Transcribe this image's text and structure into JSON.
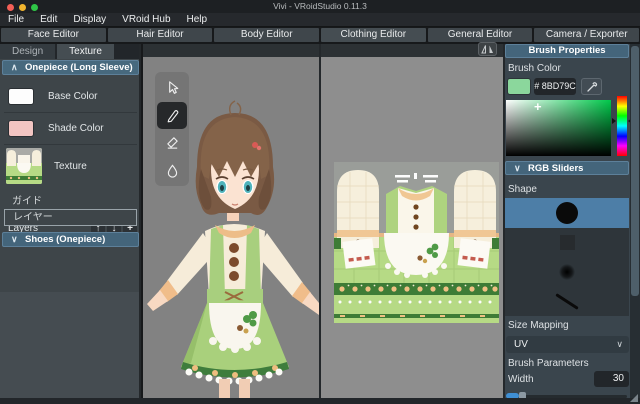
{
  "window": {
    "title": "Vivi - VRoidStudio 0.11.3"
  },
  "menu": {
    "items": [
      "File",
      "Edit",
      "Display",
      "VRoid Hub",
      "Help"
    ]
  },
  "editor_tabs": {
    "items": [
      "Face Editor",
      "Hair Editor",
      "Body Editor",
      "Clothing Editor",
      "General Editor",
      "Camera / Exporter"
    ],
    "active": "Clothing Editor"
  },
  "left_panel": {
    "tabs": {
      "design": "Design",
      "texture": "Texture",
      "active": "Texture"
    },
    "onepiece_section": {
      "label": "Onepiece (Long Sleeve)",
      "expanded": true
    },
    "items": {
      "base_color": "Base Color",
      "shade_color": "Shade Color",
      "texture": "Texture"
    },
    "layers": {
      "label": "Layers",
      "items": [
        "ガイド",
        "レイヤー"
      ],
      "selected": "レイヤー"
    },
    "shoes_section": {
      "label": "Shoes (Onepiece)",
      "expanded": false
    }
  },
  "toolbar": {
    "tools": [
      "select",
      "pen",
      "eraser",
      "blur"
    ],
    "active_tool": "pen"
  },
  "right_panel": {
    "header": "Brush Properties",
    "brush_color": {
      "label": "Brush Color",
      "hex": "# 8BD79C",
      "swatch_color": "#8BD79C"
    },
    "rgb_sliders": {
      "label": "RGB Sliders"
    },
    "shape": {
      "label": "Shape",
      "options": [
        "solid-circle",
        "square",
        "soft-circle",
        "stroke"
      ],
      "selected": "solid-circle"
    },
    "size_mapping": {
      "label": "Size Mapping",
      "value": "UV"
    },
    "brush_parameters": {
      "label": "Brush Parameters",
      "width_label": "Width",
      "width_value": "30"
    }
  },
  "icons": {
    "chevron_up": "∧",
    "chevron_down": "∨",
    "dropdown_chevron": "∨",
    "layer_up": "↑",
    "layer_down": "↓",
    "layer_add": "+",
    "sv_cursor": "+"
  },
  "colors": {
    "brush_color": "#8BD79C",
    "section_header": "#44657B",
    "selected_shape_row": "#4D7EA7",
    "slider_accent": "#3F8FD4",
    "traffic_red": "#F35F56",
    "traffic_yellow": "#F0B42E",
    "traffic_green": "#2FC547"
  }
}
